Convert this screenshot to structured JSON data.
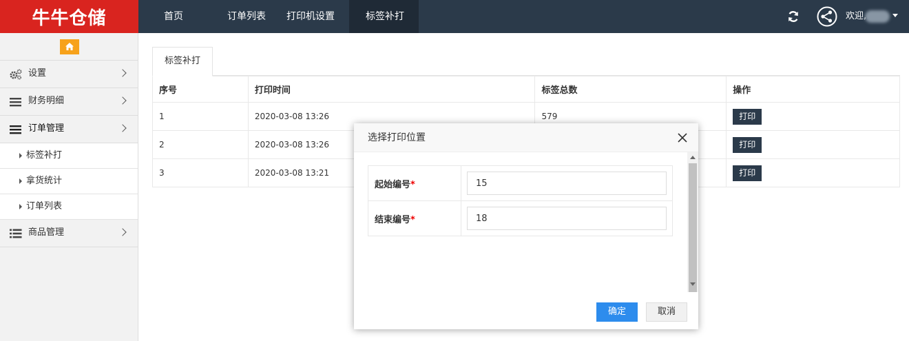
{
  "app": {
    "logo_text": "牛牛仓储"
  },
  "nav": {
    "items": [
      "首页",
      "订单列表",
      "打印机设置",
      "标签补打"
    ],
    "active_index": 3
  },
  "header": {
    "welcome": "欢迎,"
  },
  "sidebar": {
    "home_icon": "home-icon",
    "menu": [
      {
        "label": "设置",
        "icon": "gears-icon"
      },
      {
        "label": "财务明细",
        "icon": "bars-icon"
      },
      {
        "label": "订单管理",
        "icon": "bars-icon"
      },
      {
        "label": "商品管理",
        "icon": "list-icon"
      }
    ],
    "sub_items": [
      "标签补打",
      "拿货统计",
      "订单列表"
    ]
  },
  "main": {
    "tab": "标签补打",
    "table": {
      "headers": [
        "序号",
        "打印时间",
        "标签总数",
        "操作"
      ],
      "rows": [
        {
          "no": "1",
          "time": "2020-03-08 13:26",
          "count": "579",
          "action": "打印"
        },
        {
          "no": "2",
          "time": "2020-03-08 13:26",
          "count": "",
          "action": "打印"
        },
        {
          "no": "3",
          "time": "2020-03-08 13:21",
          "count": "",
          "action": "打印"
        }
      ]
    }
  },
  "dialog": {
    "title": "选择打印位置",
    "fields": [
      {
        "label": "起始编号",
        "required": "*",
        "value": "15"
      },
      {
        "label": "结束编号",
        "required": "*",
        "value": "18"
      }
    ],
    "ok_label": "确定",
    "cancel_label": "取消"
  },
  "colors": {
    "topbar": "#2b3a4a",
    "logo_bg": "#d9241f",
    "home_btn": "#f7a21b",
    "primary": "#2d8ced"
  }
}
